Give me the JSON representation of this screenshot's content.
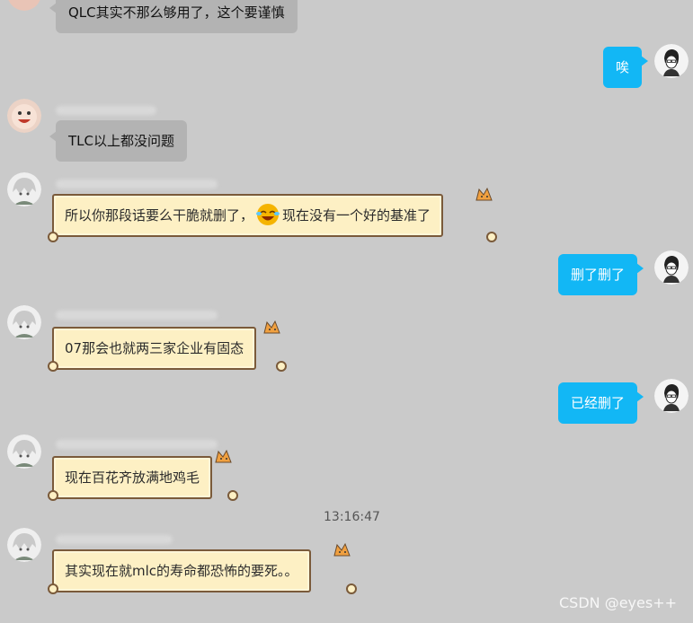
{
  "messages": {
    "m1": "QLC其实不那么够用了，这个要谨慎",
    "m2": "唉",
    "m3": "TLC以上都没问题",
    "m4_a": "所以你那段话要么干脆就删了，",
    "m4_b": "现在没有一个好的基准了",
    "m5": "删了删了",
    "m6": "07那会也就两三家企业有固态",
    "m7": "已经删了",
    "m8": "现在百花齐放满地鸡毛",
    "m9": "其实现在就mlc的寿命都恐怖的要死。。"
  },
  "timestamp": "13:16:47",
  "watermark": "CSDN @eyes++",
  "icons": {
    "emoji": "laughing-crying-emoji",
    "avatar_me": "sketch-person-avatar",
    "avatar_peer1": "cartoon-face-avatar",
    "avatar_peer2": "anime-girl-avatar"
  },
  "colors": {
    "background": "#cacaca",
    "my_bubble": "#12b7f5",
    "gray_bubble": "#b3b3b3",
    "scroll_bubble": "#fdf0c4"
  }
}
